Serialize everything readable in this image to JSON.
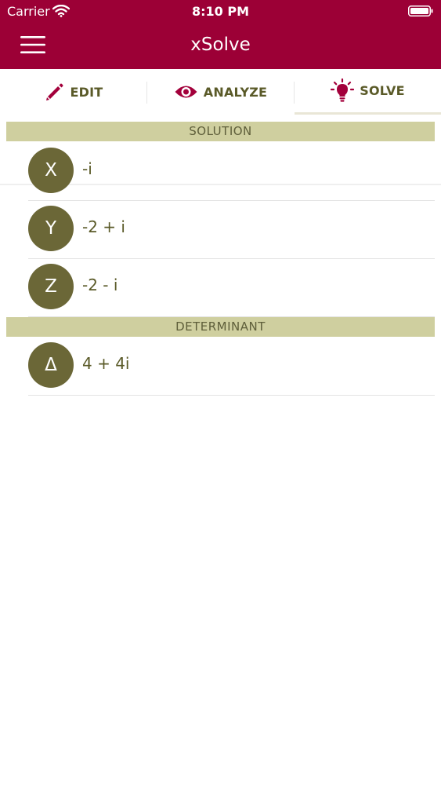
{
  "status_bar": {
    "carrier": "Carrier",
    "time": "8:10 PM"
  },
  "app_bar": {
    "title": "xSolve"
  },
  "tabs": [
    {
      "label": "EDIT",
      "icon": "pencil-icon"
    },
    {
      "label": "ANALYZE",
      "icon": "eye-icon"
    },
    {
      "label": "SOLVE",
      "icon": "lightbulb-icon",
      "active": true
    }
  ],
  "solution": {
    "header": "SOLUTION",
    "rows": [
      {
        "symbol": "X",
        "value": "-i"
      },
      {
        "symbol": "Y",
        "value": "-2 + i"
      },
      {
        "symbol": "Z",
        "value": "-2 - i"
      }
    ]
  },
  "determinant": {
    "header": "DETERMINANT",
    "rows": [
      {
        "symbol": "Δ",
        "value": "4 + 4i"
      }
    ]
  },
  "colors": {
    "app_bar": "#9c0036",
    "accent_icon": "#a3003b",
    "tab_text": "#5a5a28",
    "section_header_bg": "#cfcf9f",
    "avatar_bg": "#6b6737"
  }
}
